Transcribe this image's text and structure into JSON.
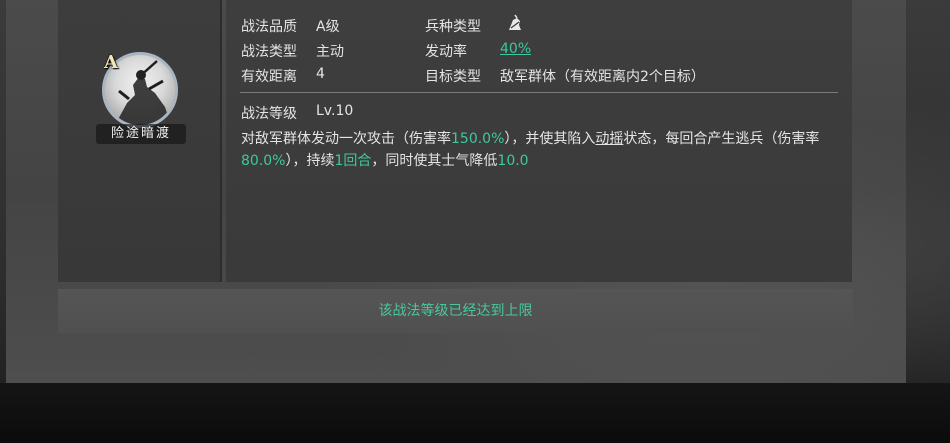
{
  "skill": {
    "grade_letter": "A",
    "name": "险途暗渡"
  },
  "info": {
    "quality_label": "战法品质",
    "quality_value": "A级",
    "troop_type_label": "兵种类型",
    "troop_type_icon": "cavalry-icon",
    "skill_type_label": "战法类型",
    "skill_type_value": "主动",
    "trigger_rate_label": "发动率",
    "trigger_rate_value": "40%",
    "range_label": "有效距离",
    "range_value": "4",
    "target_label": "目标类型",
    "target_value": "敌军群体（有效距离内2个目标）",
    "level_label": "战法等级",
    "level_value": "Lv.10"
  },
  "description": {
    "p1": "对敌军群体发动一次攻击（伤害率",
    "v1": "150.0%",
    "p2": "），并使其陷入",
    "u1": "动摇",
    "p3": "状态，每回合产生逃兵（伤害率",
    "v2": "80.0%",
    "p4": "），持续",
    "v3": "1回合",
    "p5": "，同时使其士气降低",
    "v4": "10.0"
  },
  "footer": {
    "message": "该战法等级已经达到上限"
  },
  "colors": {
    "highlight": "#3cc99f",
    "panel": "#444444",
    "text": "#e4e4e4"
  }
}
